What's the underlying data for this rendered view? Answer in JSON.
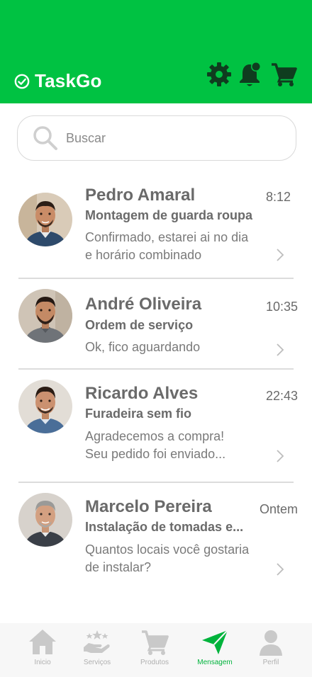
{
  "app": {
    "title": "TaskGo",
    "accent_color": "#00c242",
    "header_icons": [
      "settings-gear-icon",
      "notification-bell-icon",
      "shopping-cart-icon"
    ]
  },
  "search": {
    "placeholder": "Buscar",
    "value": ""
  },
  "conversations": [
    {
      "name": "Pedro Amaral",
      "time": "8:12",
      "subject": "Montagem de guarda roupa",
      "preview_line1": "Confirmado, estarei ai no dia",
      "preview_line2": "e horário combinado"
    },
    {
      "name": "André Oliveira",
      "time": "10:35",
      "subject": "Ordem de serviço",
      "preview_line1": "Ok, fico aguardando",
      "preview_line2": ""
    },
    {
      "name": "Ricardo Alves",
      "time": "22:43",
      "subject": "Furadeira sem fio",
      "preview_line1": "Agradecemos a compra!",
      "preview_line2": "Seu pedido foi enviado..."
    },
    {
      "name": "Marcelo Pereira",
      "time": "Ontem",
      "subject": "Instalação de tomadas e...",
      "preview_line1": "Quantos locais você gostaria",
      "preview_line2": "de instalar?"
    }
  ],
  "bottom_nav": [
    {
      "label": "Inicio",
      "icon": "home-icon",
      "active": false
    },
    {
      "label": "Serviços",
      "icon": "services-hand-stars-icon",
      "active": false
    },
    {
      "label": "Produtos",
      "icon": "cart-icon",
      "active": false
    },
    {
      "label": "Mensagem",
      "icon": "send-message-icon",
      "active": true
    },
    {
      "label": "Perfil",
      "icon": "profile-icon",
      "active": false
    }
  ]
}
